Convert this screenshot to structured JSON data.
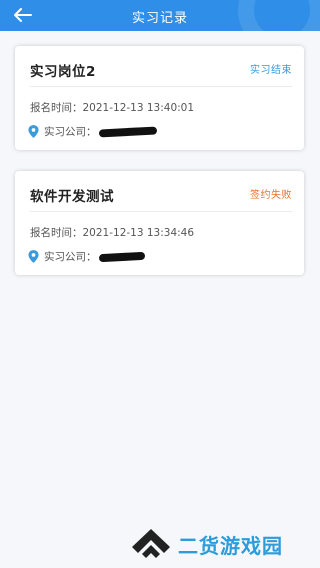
{
  "header": {
    "title": "实习记录",
    "back_icon": "arrow-left-icon",
    "color": "#2f8fe8"
  },
  "labels": {
    "time_prefix": "报名时间：",
    "company_prefix": "实习公司："
  },
  "records": [
    {
      "job": "实习岗位2",
      "status": "实习结束",
      "status_color": "#3b9ad9",
      "time": "2021-12-13 13:40:01"
    },
    {
      "job": "软件开发测试",
      "status": "签约失败",
      "status_color": "#e8702a",
      "time": "2021-12-13 13:34:46"
    }
  ],
  "watermark": {
    "text": "二货游戏园",
    "color": "#2d9cdb"
  }
}
